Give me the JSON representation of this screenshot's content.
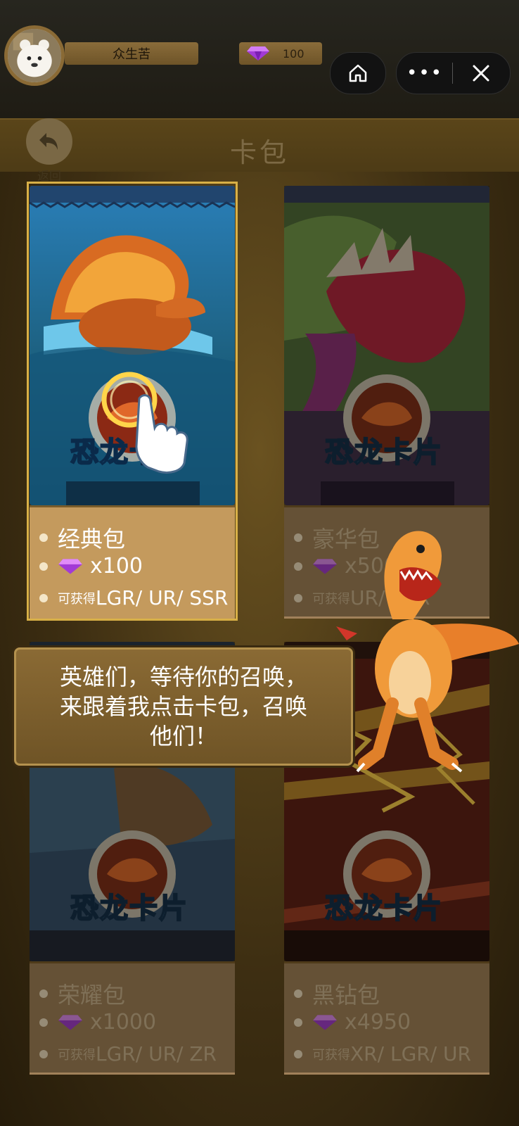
{
  "top_bar": {
    "player_name": "众生苦",
    "gem_count": "100",
    "gem_icon": "purple-gem-icon",
    "avatar_icon": "bear-avatar-icon"
  },
  "mini_program": {
    "home_icon": "home-icon",
    "more_icon": "more-dots-icon",
    "close_icon": "close-icon"
  },
  "header": {
    "back_label": "返回",
    "title": "卡包"
  },
  "packs": [
    {
      "name": "经典包",
      "price": "x100",
      "drops_label": "可获得",
      "drops": "LGR/ UR/ SSR",
      "logo": "恐龙卡片"
    },
    {
      "name": "豪华包",
      "price": "x500",
      "drops_label": "可获得",
      "drops": "UR/ SSR",
      "logo": "恐龙卡片"
    },
    {
      "name": "荣耀包",
      "price": "x1000",
      "drops_label": "可获得",
      "drops": "LGR/ UR/ ZR",
      "logo": "恐龙卡片"
    },
    {
      "name": "黑钻包",
      "price": "x4950",
      "drops_label": "可获得",
      "drops": "XR/ LGR/ UR",
      "logo": "恐龙卡片"
    }
  ],
  "tutorial": {
    "line1": "英雄们，等待你的召唤，",
    "line2": "来跟着我点击卡包，召唤",
    "line3": "他们！"
  },
  "colors": {
    "accent_gold": "#d8b047",
    "gem_purple": "#a23ad6",
    "info_panel": "#c49a5d"
  }
}
